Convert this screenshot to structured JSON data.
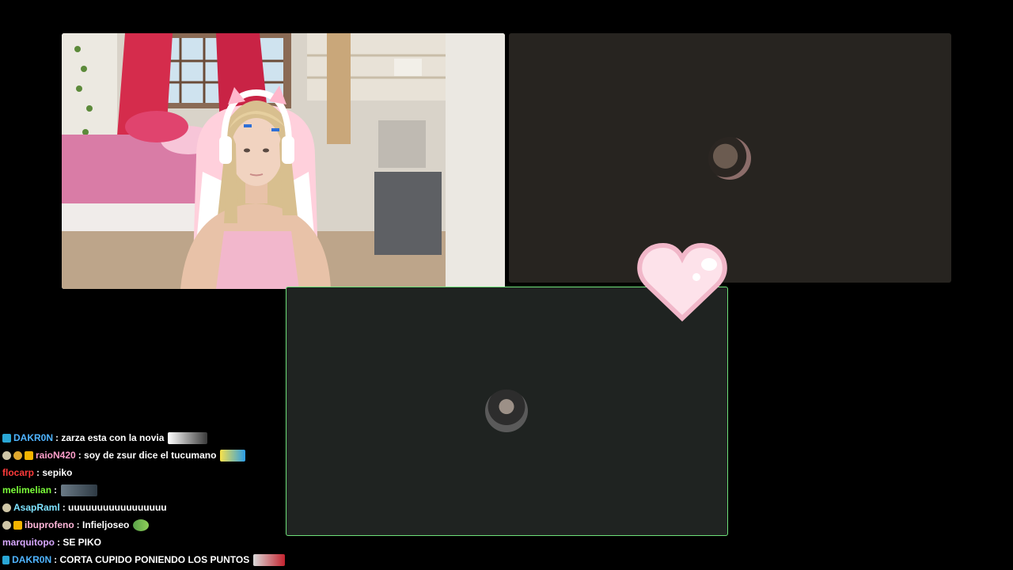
{
  "tiles": {
    "webcam": {
      "label": ""
    },
    "right": {
      "label": ""
    },
    "bottom": {
      "label": ""
    }
  },
  "overlay": {
    "heart_icon": "pixel-heart-icon"
  },
  "colors": {
    "active_border": "#6ee07a"
  },
  "chat": [
    {
      "user": "DAKR0N",
      "user_color": "#4fb4ff",
      "message": ": zarza esta con la novia",
      "badges": [
        "badge-blue"
      ],
      "emote": "emote-image"
    },
    {
      "user": "raioN420",
      "user_color": "#ff9fcb",
      "message": ": soy de zsur dice el tucumano",
      "badges": [
        "badge-gray",
        "badge-gold",
        "badge-orange"
      ],
      "emote": "emote-image"
    },
    {
      "user": "flocarp",
      "user_color": "#ff3b3b",
      "message": ": sepiko",
      "badges": [],
      "emote": ""
    },
    {
      "user": "melimelian",
      "user_color": "#7cff3a",
      "message": ":",
      "badges": [],
      "emote": "emote-image"
    },
    {
      "user": "AsapRaml",
      "user_color": "#7fe3ff",
      "message": ": uuuuuuuuuuuuuuuuu",
      "badges": [
        "badge-gray"
      ],
      "emote": ""
    },
    {
      "user": "ibuprofeno",
      "user_color": "#ffb6d9",
      "message": ": Infieljoseo",
      "badges": [
        "badge-gray",
        "badge-orange"
      ],
      "emote": "emote-image"
    },
    {
      "user": "marquitopo",
      "user_color": "#d8a8ff",
      "message": ": SE PIKO",
      "badges": [],
      "emote": ""
    },
    {
      "user": "DAKR0N",
      "user_color": "#4fb4ff",
      "message": ": CORTA CUPIDO PONIENDO LOS PUNTOS",
      "badges": [
        "badge-blue"
      ],
      "emote": "emote-image"
    }
  ]
}
